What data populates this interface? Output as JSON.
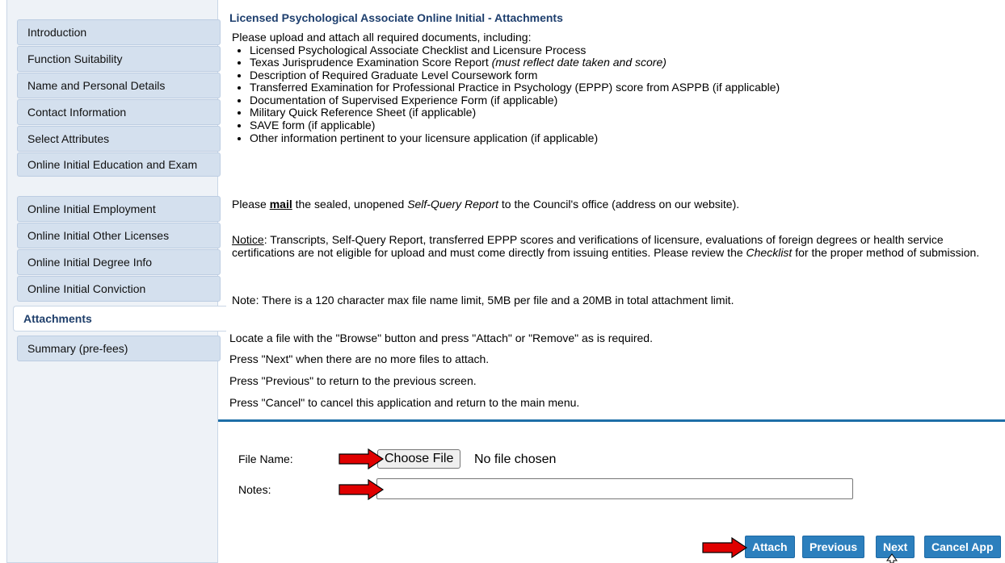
{
  "sidebar": {
    "items": [
      {
        "label": "Introduction"
      },
      {
        "label": "Function Suitability"
      },
      {
        "label": "Name and Personal Details"
      },
      {
        "label": "Contact Information"
      },
      {
        "label": "Select Attributes"
      },
      {
        "label": "Online Initial Education and Exam"
      },
      {
        "label": "Online Initial Employment"
      },
      {
        "label": "Online Initial Other Licenses"
      },
      {
        "label": "Online Initial Degree Info"
      },
      {
        "label": "Online Initial Conviction"
      },
      {
        "label": "Attachments",
        "active": true
      },
      {
        "label": "Summary (pre-fees)"
      }
    ]
  },
  "main": {
    "title": "Licensed Psychological Associate Online Initial - Attachments",
    "intro": "Please upload and attach all required documents, including:",
    "documents": [
      {
        "text": "Licensed Psychological Associate Checklist and Licensure Process"
      },
      {
        "text": "Texas Jurisprudence Examination Score Report ",
        "em": "(must reflect date taken and score)"
      },
      {
        "text": "Description of Required Graduate Level Coursework form"
      },
      {
        "text": "Transferred Examination for Professional Practice in Psychology (EPPP) score from ASPPB (if applicable)"
      },
      {
        "text": "Documentation of Supervised Experience Form (if applicable)"
      },
      {
        "text": "Military Quick Reference Sheet (if applicable)"
      },
      {
        "text": "SAVE form (if applicable)"
      },
      {
        "text": "Other information pertinent to your licensure application (if applicable)"
      }
    ],
    "mail_para": {
      "pre": "Please ",
      "mail": "mail",
      "mid": " the sealed, unopened ",
      "report": "Self-Query Report",
      "post": " to the Council's office (address on our website)."
    },
    "notice_para": {
      "label": "Notice",
      "text": ": Transcripts, Self-Query Report, transferred EPPP scores and verifications of licensure, evaluations of foreign degrees or health service certifications are not eligible for upload and must come directly from issuing entities. Please review the ",
      "checklist": "Checklist",
      "post": " for the proper method of submission."
    },
    "note": "Note: There is a 120 character max file name limit, 5MB per file and a 20MB in total attachment limit.",
    "instructions": [
      "Locate a file with the \"Browse\" button and press \"Attach\" or \"Remove\" as is required.",
      "Press \"Next\" when there are no more files to attach.",
      "Press \"Previous\" to return to the previous screen.",
      "Press \"Cancel\" to cancel this application and return to the main menu."
    ]
  },
  "form": {
    "file_label": "File Name:",
    "choose_file": "Choose File",
    "no_file": "No file chosen",
    "notes_label": "Notes:",
    "notes_value": ""
  },
  "buttons": {
    "attach": "Attach",
    "previous": "Previous",
    "next": "Next",
    "cancel": "Cancel App"
  },
  "colors": {
    "accent": "#2c7fbd",
    "title": "#1e3f6e",
    "arrow": "#e00000",
    "divider": "#1d6ea7"
  }
}
